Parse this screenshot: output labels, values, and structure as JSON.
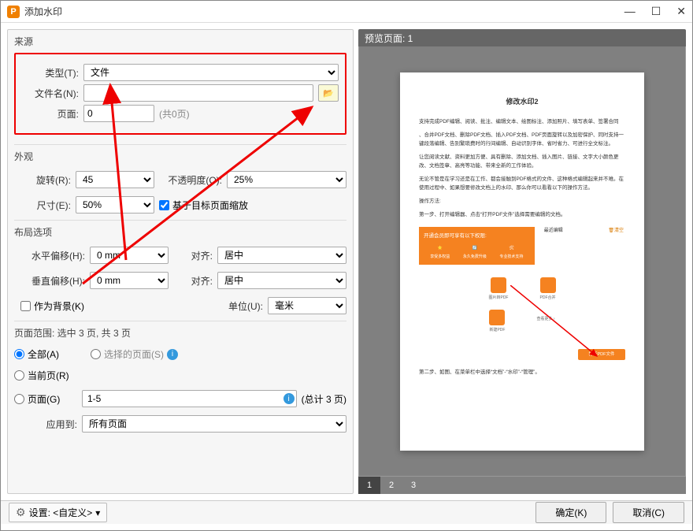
{
  "window": {
    "title": "添加水印",
    "min_btn": "—",
    "max_btn": "☐",
    "close_btn": "✕"
  },
  "source": {
    "group_label": "来源",
    "type_label": "类型(T):",
    "type_value": "文件",
    "filename_label": "文件名(N):",
    "filename_value": "",
    "browse_icon": "📂",
    "page_label": "页面:",
    "page_value": "0",
    "page_total": "(共0页)"
  },
  "appearance": {
    "group_label": "外观",
    "rotate_label": "旋转(R):",
    "rotate_value": "45",
    "opacity_label": "不透明度(O):",
    "opacity_value": "25%",
    "scale_label": "尺寸(E):",
    "scale_value": "50%",
    "scale_rel_checked": true,
    "scale_rel_label": "基于目标页面缩放"
  },
  "layout": {
    "group_label": "布局选项",
    "hoff_label": "水平偏移(H):",
    "hoff_value": "0 mm",
    "halign_label": "对齐:",
    "halign_value": "居中",
    "voff_label": "垂直偏移(H):",
    "voff_value": "0 mm",
    "valign_label": "对齐:",
    "valign_value": "居中",
    "as_background_label": "作为背景(K)",
    "unit_label": "单位(U):",
    "unit_value": "毫米"
  },
  "page_range": {
    "group_label": "页面范围: 选中 3 页, 共 3 页",
    "opt_all": "全部(A)",
    "opt_selected": "选择的页面(S)",
    "opt_current": "当前页(R)",
    "opt_pages": "页面(G)",
    "pages_value": "1-5",
    "pages_total": "(总计 3 页)",
    "apply_to_label": "应用到:",
    "apply_to_value": "所有页面"
  },
  "preview": {
    "bar_label": "预览页面: 1",
    "doc_title": "修改水印2",
    "p1": "支持完成PDF编辑、阅读、批注、编辑文本、绘图标注、添加照片、填写表单、签署合同",
    "p2": "、合并PDF文档、删除PDF文档、插入PDF文档、PDF页面旋转以及加密保护、同时支持一键段落编辑、告别繁琐费时的行间编辑、自动识别字体、省时省力、可进行全文标注。",
    "p3": "让您阅读文献、资料更加方便、具有删除、添加文档、插入图片、链接、文字大小颜色更改、文档签章、高亮等功能、带来全新的工作体验。",
    "p4": "无论不管是在学习还是在工作、都会接触到PDF格式的文件、这种格式编辑起来并不难。在使用过程中、如果想要修改文档上的水印、那么你可以看看以下的操作方法。",
    "p5": "操作方法:",
    "p6": "第一步、打开编辑器、点击“打开PDF文件”选择需要编辑的文档。",
    "orange_hdr": "开通会员即可享有以下权限:",
    "orange_i1": "享受多权益",
    "orange_i2": "永久免费升级",
    "orange_i3": "专业技术支持",
    "recent_label": "最近编辑",
    "clear_label": "🗑清空",
    "tile1": "图片转PDF",
    "tile2": "PDF合并",
    "tile3": "新建PDF",
    "more_label": "查看更多 ›",
    "open_btn": "打开PDF文件",
    "p7": "第二步、如图、在菜单栏中选择“文档”-“水印”-“管理”。",
    "thumbs": [
      "1",
      "2",
      "3"
    ]
  },
  "footer": {
    "settings_label": "设置: <自定义>",
    "ok": "确定(K)",
    "cancel": "取消(C)"
  }
}
